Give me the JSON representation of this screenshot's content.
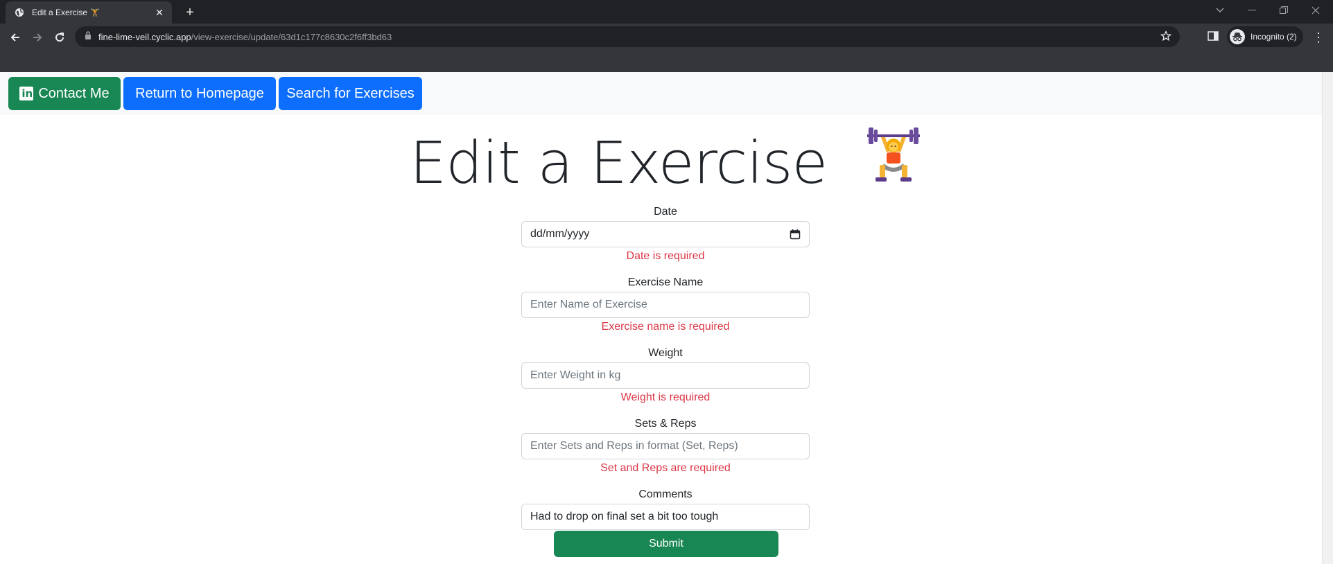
{
  "browser": {
    "tab_title": "Edit a Exercise",
    "tab_emoji": "🏋",
    "url_host": "fine-lime-veil.cyclic.app",
    "url_path": "/view-exercise/update/63d1c177c8630c2f6ff3bd63",
    "profile_label": "Incognito (2)"
  },
  "navbar": {
    "contact_label": "Contact Me",
    "home_label": "Return to Homepage",
    "search_label": "Search for Exercises"
  },
  "page": {
    "title": "Edit a Exercise"
  },
  "form": {
    "date": {
      "label": "Date",
      "value": "dd/mm/yyyy",
      "error": "Date is required"
    },
    "name": {
      "label": "Exercise Name",
      "placeholder": "Enter Name of Exercise",
      "error": "Exercise name is required"
    },
    "weight": {
      "label": "Weight",
      "placeholder": "Enter Weight in kg",
      "error": "Weight is required"
    },
    "sets": {
      "label": "Sets & Reps",
      "placeholder": "Enter Sets and Reps in format (Set, Reps)",
      "error": "Set and Reps are required"
    },
    "comments": {
      "label": "Comments",
      "value": "Had to drop on final set a bit too tough"
    },
    "submit_label": "Submit"
  },
  "colors": {
    "success": "#198754",
    "primary": "#0d6efd",
    "danger": "#dc3545"
  }
}
